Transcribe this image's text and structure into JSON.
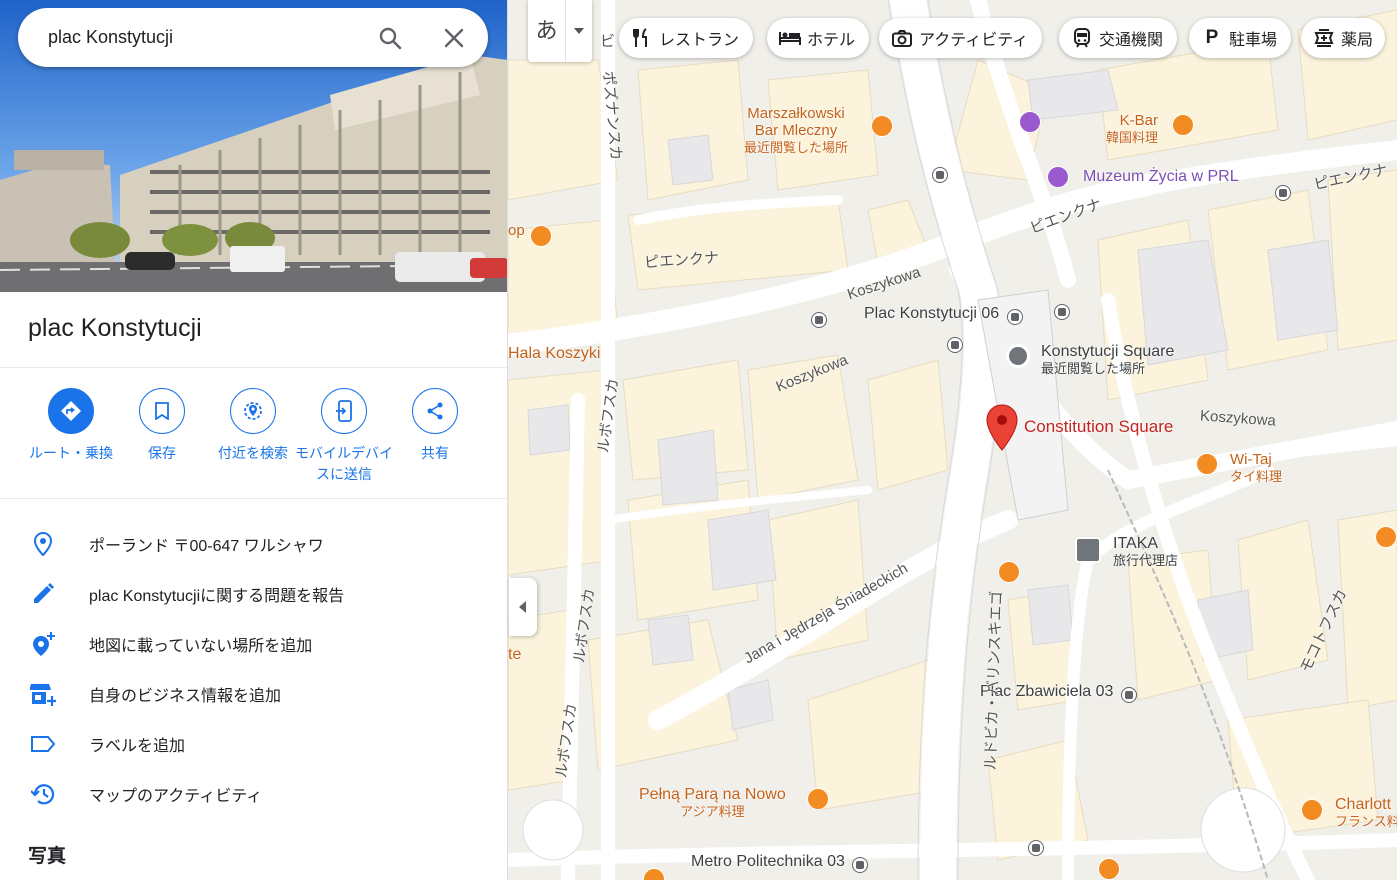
{
  "search": {
    "query": "plac Konstytucji"
  },
  "place": {
    "title": "plac Konstytucji"
  },
  "actions": [
    {
      "label": "ルート・乗換",
      "icon": "directions-icon"
    },
    {
      "label": "保存",
      "icon": "bookmark-icon"
    },
    {
      "label": "付近を検索",
      "icon": "nearby-icon"
    },
    {
      "label": "モバイルデバイスに送信",
      "icon": "send-to-phone-icon"
    },
    {
      "label": "共有",
      "icon": "share-icon"
    }
  ],
  "info": [
    {
      "text": "ポーランド 〒00-647 ワルシャワ",
      "icon": "location-pin-icon"
    },
    {
      "text": "plac Konstytucjiに関する問題を報告",
      "icon": "pencil-icon"
    },
    {
      "text": "地図に載っていない場所を追加",
      "icon": "add-place-icon"
    },
    {
      "text": "自身のビジネス情報を追加",
      "icon": "add-business-icon"
    },
    {
      "text": "ラベルを追加",
      "icon": "label-icon"
    },
    {
      "text": "マップのアクティビティ",
      "icon": "history-icon"
    }
  ],
  "photos_heading": "写真",
  "ime": {
    "char": "あ"
  },
  "chips": [
    {
      "label": "レストラン",
      "icon": "restaurant-icon"
    },
    {
      "label": "ホテル",
      "icon": "hotel-icon"
    },
    {
      "label": "アクティビティ",
      "icon": "camera-icon"
    },
    {
      "label": "交通機関",
      "icon": "transit-icon"
    },
    {
      "label": "駐車場",
      "icon": "parking-icon"
    },
    {
      "label": "薬局",
      "icon": "pharmacy-icon"
    }
  ],
  "map": {
    "poi": {
      "marszalkowski": "Marszałkowski",
      "marszalkowski_2": "Bar Mleczny",
      "marszalkowski_sub": "最近閲覧した場所",
      "kbar": "K-Bar",
      "kbar_sub": "韓国料理",
      "muzeum": "Muzeum Życia w PRL",
      "hala": "Hala Koszyki",
      "konst_square": "Konstytucji Square",
      "konst_square_sub": "最近閲覧した場所",
      "constitution": "Constitution Square",
      "witaj": "Wi-Taj",
      "witaj_sub": "タイ料理",
      "itaka": "ITAKA",
      "itaka_sub": "旅行代理店",
      "pelna": "Pełną Parą na Nowo",
      "pelna_sub": "アジア料理",
      "charlott": "Charlott",
      "charlott_sub": "フランス料",
      "op": "op",
      "te": "te"
    },
    "transit": {
      "plac06": "Plac Konstytucji 06",
      "zbawiciela": "Plac Zbawiciela 03",
      "metro": "Metro Politechnika 03"
    },
    "streets": {
      "koszykowa1": "Koszykowa",
      "koszykowa2": "Koszykowa",
      "koszykowa3": "Koszykowa",
      "piekna1": "ピエンクナ",
      "piekna2": "ピエンクナ",
      "piekna3": "ピエンクナ",
      "poznanska": "ポズナンスカ",
      "lwowska1": "ルボフスカ",
      "lwowska2": "ルボフスカ",
      "lwowska3": "ルボフスカ",
      "sniadeckich": "Jana i Jędrzeja Śniadeckich",
      "marszalkowska": "ルドビカ・バリンスキエゴ",
      "mokotowska": "モコトフスカ",
      "bi": "ビ"
    }
  }
}
